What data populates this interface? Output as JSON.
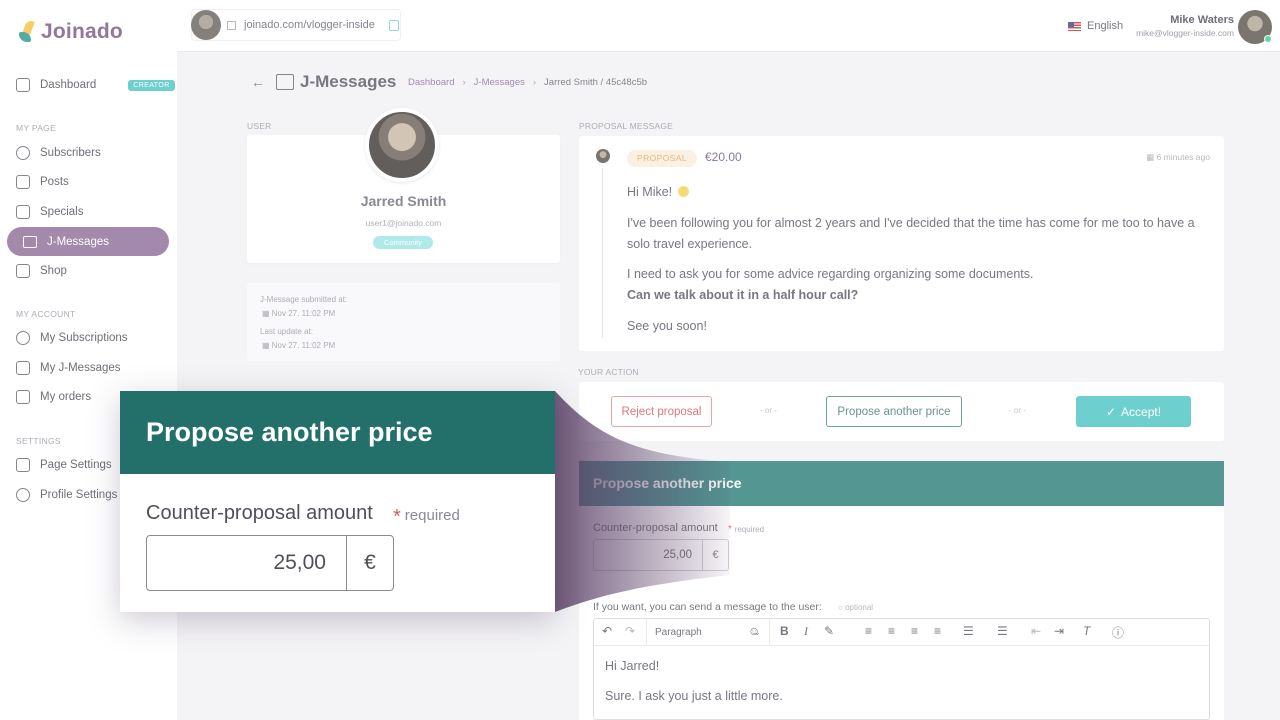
{
  "brand": {
    "name": "Joinado"
  },
  "sidebar": {
    "dashboard": "Dashboard",
    "creator_badge": "CREATOR",
    "section_my_page": "MY PAGE",
    "subscribers": "Subscribers",
    "posts": "Posts",
    "specials": "Specials",
    "jmessages": "J-Messages",
    "shop": "Shop",
    "section_my_account": "MY ACCOUNT",
    "my_subscriptions": "My Subscriptions",
    "my_jmessages": "My J-Messages",
    "my_orders": "My orders",
    "section_settings": "SETTINGS",
    "page_settings": "Page Settings",
    "profile_settings": "Profile Settings"
  },
  "topbar": {
    "url": "joinado.com/vlogger-inside",
    "language": "English",
    "user_name": "Mike Waters",
    "user_email": "mike@vlogger-inside.com"
  },
  "header": {
    "title": "J-Messages",
    "breadcrumb": [
      "Dashboard",
      "J-Messages",
      "Jarred Smith / 45c48c5b"
    ]
  },
  "user_panel": {
    "label": "USER",
    "name": "Jarred Smith",
    "email": "user1@joinado.com",
    "badge": "Community",
    "submitted_label": "J-Message submitted at:",
    "submitted_date": "Nov 27, 11:02 PM",
    "updated_label": "Last update at:",
    "updated_date": "Nov 27, 11:02 PM"
  },
  "proposal": {
    "label": "PROPOSAL MESSAGE",
    "badge": "PROPOSAL",
    "price": "€20.00",
    "time": "6 minutes ago",
    "greeting": "Hi Mike!",
    "p1": "I've been following you for almost 2 years and I've decided that the time has come for me too to have a solo travel experience.",
    "p2": "I need to ask you for some advice regarding organizing some documents.",
    "p2_bold": "Can we talk about it in a half hour call?",
    "p3": "See you soon!"
  },
  "action": {
    "label": "YOUR ACTION",
    "reject": "Reject proposal",
    "or": "- or -",
    "propose": "Propose another price",
    "accept": "Accept!"
  },
  "propose_panel": {
    "title": "Propose another price",
    "amount_label": "Counter-proposal amount",
    "required": "required",
    "amount_value": "25,00",
    "currency": "€",
    "message_label": "If you want, you can send a message to the user:",
    "optional": "optional",
    "format_select": "Paragraph",
    "editor_line1": "Hi Jarred!",
    "editor_line2": "Sure. I ask you just a little more."
  },
  "zoom": {
    "title": "Propose another price",
    "amount_label": "Counter-proposal amount",
    "required": "required",
    "amount_value": "25,00",
    "currency": "€"
  },
  "colors": {
    "brand_purple": "#8f6f99",
    "teal_header": "#2e7f7a",
    "accent_teal": "#4fc6c4",
    "reject_red": "#d65b5b"
  }
}
